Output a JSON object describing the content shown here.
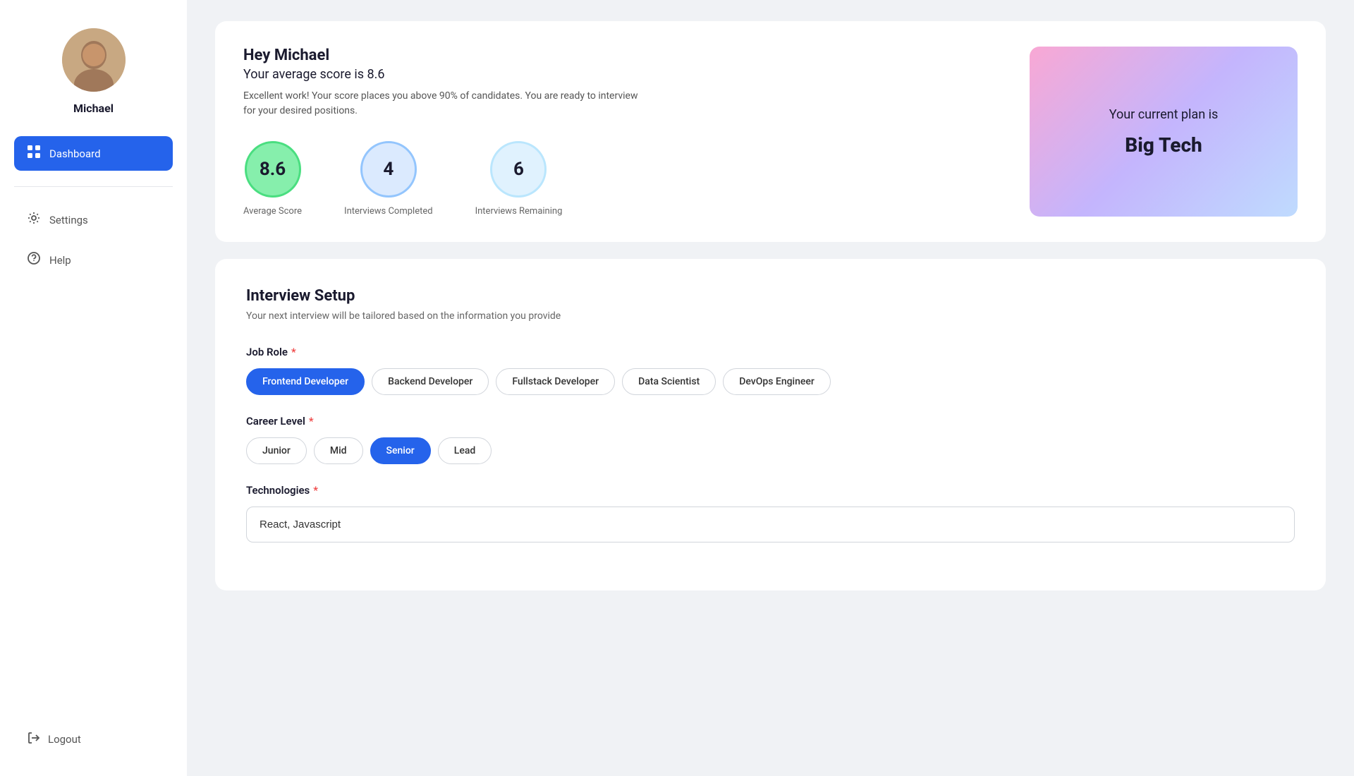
{
  "sidebar": {
    "user": {
      "name": "Michael"
    },
    "nav": [
      {
        "id": "dashboard",
        "label": "Dashboard",
        "active": true
      },
      {
        "id": "settings",
        "label": "Settings",
        "active": false
      },
      {
        "id": "help",
        "label": "Help",
        "active": false
      }
    ],
    "logout_label": "Logout"
  },
  "top_card": {
    "greeting": "Hey Michael",
    "avg_score_line": "Your average score is 8.6",
    "description": "Excellent work! Your score places you above 90% of candidates. You are ready to interview for your desired positions.",
    "stats": [
      {
        "id": "avg-score",
        "value": "8.6",
        "label": "Average Score",
        "style": "green"
      },
      {
        "id": "interviews-completed",
        "value": "4",
        "label": "Interviews Completed",
        "style": "blue-light"
      },
      {
        "id": "interviews-remaining",
        "value": "6",
        "label": "Interviews Remaining",
        "style": "blue-lighter"
      }
    ],
    "plan": {
      "prefix": "Your current plan is",
      "name": "Big Tech"
    }
  },
  "interview_setup": {
    "title": "Interview Setup",
    "subtitle": "Your next interview will be tailored based on the information you provide",
    "job_role": {
      "label": "Job Role",
      "required": true,
      "options": [
        "Frontend Developer",
        "Backend Developer",
        "Fullstack Developer",
        "Data Scientist",
        "DevOps Engineer"
      ],
      "selected": "Frontend Developer"
    },
    "career_level": {
      "label": "Career Level",
      "required": true,
      "options": [
        "Junior",
        "Mid",
        "Senior",
        "Lead"
      ],
      "selected": "Senior"
    },
    "technologies": {
      "label": "Technologies",
      "required": true,
      "value": "React, Javascript",
      "placeholder": "React, Javascript"
    }
  }
}
